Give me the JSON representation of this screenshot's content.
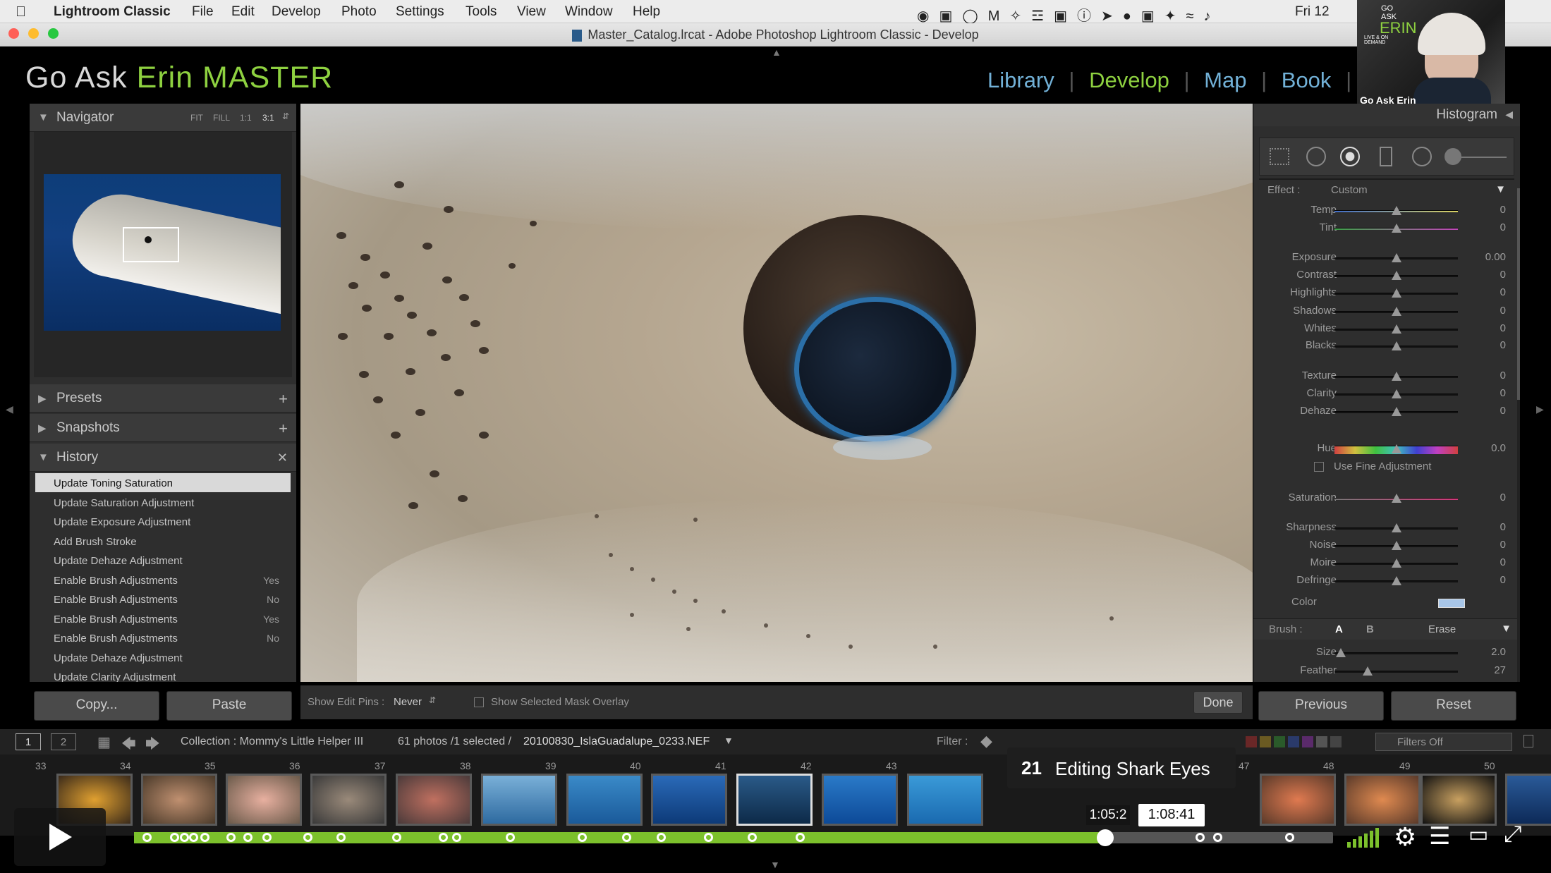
{
  "menubar": {
    "app": "Lightroom Classic",
    "items": [
      "File",
      "Edit",
      "Develop",
      "Photo",
      "Settings",
      "Tools",
      "View",
      "Window",
      "Help"
    ],
    "clock": "Fri 12"
  },
  "window": {
    "title": "Master_Catalog.lrcat - Adobe Photoshop Lightroom Classic - Develop"
  },
  "identity": {
    "prefix": "Go Ask",
    "name": "Erin MASTER"
  },
  "modules": [
    "Library",
    "Develop",
    "Map",
    "Book"
  ],
  "webcam": {
    "logo_top": "GO ASK",
    "logo_name": "ERIN",
    "logo_tag": "LIVE & ON DEMAND",
    "caption": "Go Ask Erin"
  },
  "navigator": {
    "title": "Navigator",
    "zoom": [
      "FIT",
      "FILL",
      "1:1",
      "3:1"
    ]
  },
  "presets": {
    "title": "Presets"
  },
  "snapshots": {
    "title": "Snapshots"
  },
  "history": {
    "title": "History",
    "items": [
      {
        "label": "Update Toning Saturation",
        "value": ""
      },
      {
        "label": "Update Saturation Adjustment",
        "value": ""
      },
      {
        "label": "Update Exposure Adjustment",
        "value": ""
      },
      {
        "label": "Add Brush Stroke",
        "value": ""
      },
      {
        "label": "Update Dehaze Adjustment",
        "value": ""
      },
      {
        "label": "Enable Brush Adjustments",
        "value": "Yes"
      },
      {
        "label": "Enable Brush Adjustments",
        "value": "No"
      },
      {
        "label": "Enable Brush Adjustments",
        "value": "Yes"
      },
      {
        "label": "Enable Brush Adjustments",
        "value": "No"
      },
      {
        "label": "Update Dehaze Adjustment",
        "value": ""
      },
      {
        "label": "Update Clarity Adjustment",
        "value": ""
      }
    ]
  },
  "left_buttons": {
    "copy": "Copy...",
    "paste": "Paste"
  },
  "toolbar": {
    "pins_label": "Show Edit Pins :",
    "pins_value": "Never",
    "overlay_label": "Show Selected Mask Overlay",
    "done": "Done"
  },
  "histogram": {
    "title": "Histogram"
  },
  "effect": {
    "label": "Effect :",
    "value": "Custom"
  },
  "sliders": [
    {
      "label": "Temp",
      "value": "0",
      "pos": 0.5
    },
    {
      "label": "Tint",
      "value": "0",
      "pos": 0.5
    },
    {
      "label": "Exposure",
      "value": "0.00",
      "pos": 0.5
    },
    {
      "label": "Contrast",
      "value": "0",
      "pos": 0.5
    },
    {
      "label": "Highlights",
      "value": "0",
      "pos": 0.5
    },
    {
      "label": "Shadows",
      "value": "0",
      "pos": 0.5
    },
    {
      "label": "Whites",
      "value": "0",
      "pos": 0.5
    },
    {
      "label": "Blacks",
      "value": "0",
      "pos": 0.5
    },
    {
      "label": "Texture",
      "value": "0",
      "pos": 0.5
    },
    {
      "label": "Clarity",
      "value": "0",
      "pos": 0.5
    },
    {
      "label": "Dehaze",
      "value": "0",
      "pos": 0.5
    },
    {
      "label": "Hue",
      "value": "0.0",
      "pos": 0.5
    },
    {
      "label": "Saturation",
      "value": "0",
      "pos": 0.5
    },
    {
      "label": "Sharpness",
      "value": "0",
      "pos": 0.5
    },
    {
      "label": "Noise",
      "value": "0",
      "pos": 0.5
    },
    {
      "label": "Moire",
      "value": "0",
      "pos": 0.5
    },
    {
      "label": "Defringe",
      "value": "0",
      "pos": 0.5
    }
  ],
  "fine_adjust": "Use Fine Adjustment",
  "color_label": "Color",
  "brush": {
    "label": "Brush :",
    "a": "A",
    "b": "B",
    "erase": "Erase",
    "size": {
      "label": "Size",
      "value": "2.0",
      "pos": 0.05
    },
    "feather": {
      "label": "Feather",
      "value": "27",
      "pos": 0.27
    }
  },
  "right_buttons": {
    "previous": "Previous",
    "reset": "Reset"
  },
  "filmstrip": {
    "pages": [
      "1",
      "2"
    ],
    "collection": "Collection : Mommy's Little Helper III",
    "count": "61 photos /1 selected /",
    "filename": "20100830_IslaGuadalupe_0233.NEF",
    "filter_label": "Filter :",
    "filter_value": "Filters Off",
    "numbers": [
      "33",
      "34",
      "35",
      "36",
      "37",
      "38",
      "39",
      "40",
      "41",
      "42",
      "43",
      "47",
      "48",
      "49",
      "50"
    ]
  },
  "video": {
    "chapter_num": "21",
    "chapter_title": "Editing Shark Eyes",
    "current": "1:05:2",
    "hover": "1:08:41",
    "progress": 0.81
  }
}
